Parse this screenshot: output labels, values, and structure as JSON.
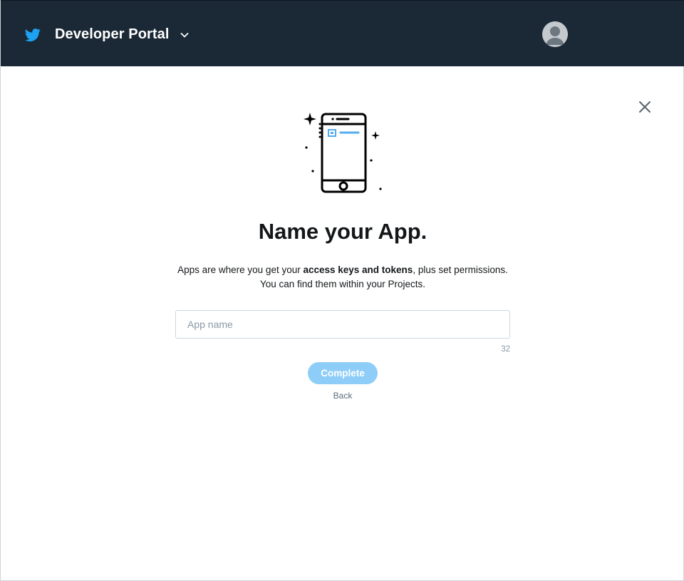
{
  "header": {
    "title": "Developer Portal",
    "brand_icon": "twitter-bird-icon",
    "brand_color": "#1da1f2",
    "background_color": "#1b2836",
    "menu_icon": "chevron-down-icon",
    "avatar_icon": "user-avatar-icon"
  },
  "dialog": {
    "close_icon": "close-icon",
    "illustration_icon": "smartphone-sparkle-icon",
    "heading": "Name your App.",
    "description": {
      "part1": "Apps are where you get your ",
      "bold": "access keys and tokens",
      "part2": ", plus set permissions.",
      "line2": "You can find them within your Projects."
    },
    "app_name_field": {
      "placeholder": "App name",
      "value": "",
      "char_remaining": "32"
    },
    "complete_label": "Complete",
    "complete_color": "#8ecdf8",
    "back_label": "Back"
  }
}
